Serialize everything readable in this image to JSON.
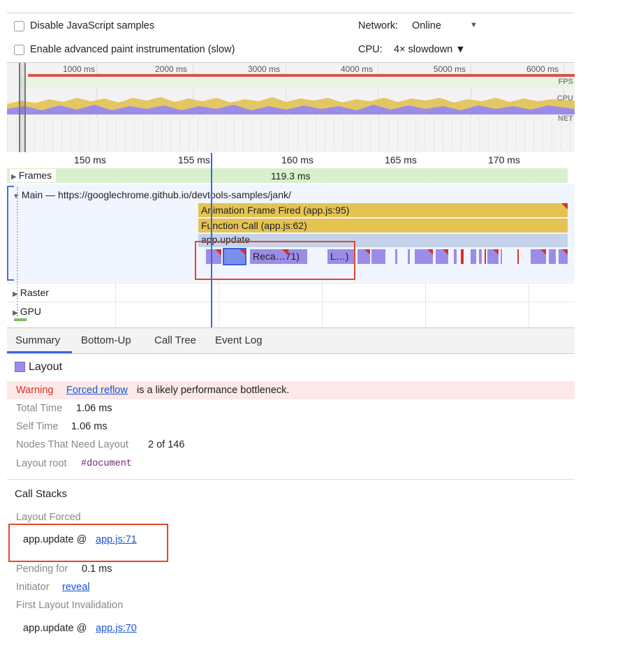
{
  "settings": {
    "disable_js_samples": "Disable JavaScript samples",
    "advanced_paint": "Enable advanced paint instrumentation (slow)",
    "network_label": "Network:",
    "network_value": "Online",
    "network_arrow": "▼",
    "cpu_label": "CPU:",
    "cpu_value": "4× slowdown ▼"
  },
  "overview": {
    "ticks": [
      "1000 ms",
      "2000 ms",
      "3000 ms",
      "4000 ms",
      "5000 ms",
      "6000 ms"
    ],
    "fps": "FPS",
    "cpu": "CPU",
    "net": "NET"
  },
  "ruler": {
    "ticks": [
      "150 ms",
      "155 ms",
      "160 ms",
      "165 ms",
      "170 ms"
    ]
  },
  "tracks": {
    "frames_label": "Frames",
    "frames_duration": "119.3 ms",
    "main_label": "Main — https://googlechrome.github.io/devtools-samples/jank/",
    "animation_frame": "Animation Frame Fired (app.js:95)",
    "function_call": "Function Call (app.js:62)",
    "app_update": "app.update",
    "recalc": "Reca…71)",
    "layout_short": "L…)",
    "raster_label": "Raster",
    "gpu_label": "GPU"
  },
  "tabs": [
    "Summary",
    "Bottom-Up",
    "Call Tree",
    "Event Log"
  ],
  "summary": {
    "title": "Layout",
    "warning_label": "Warning",
    "warning_link": "Forced reflow",
    "warning_text": "is a likely performance bottleneck.",
    "total_time_label": "Total Time",
    "total_time": "1.06 ms",
    "self_time_label": "Self Time",
    "self_time": "1.06 ms",
    "nodes_label": "Nodes That Need Layout",
    "nodes": "2 of 146",
    "layout_root_label": "Layout root",
    "layout_root": "#document"
  },
  "call_stacks": {
    "title": "Call Stacks",
    "layout_forced_label": "Layout Forced",
    "frame1_fn": "app.update @",
    "frame1_link": "app.js:71",
    "pending_label": "Pending for",
    "pending_value": "0.1 ms",
    "initiator_label": "Initiator",
    "initiator_link": "reveal",
    "first_invalidation_label": "First Layout Invalidation",
    "frame2_fn": "app.update @",
    "frame2_link": "app.js:70"
  },
  "colors": {
    "layout_purple": "#9b8ce8",
    "scripting_yellow": "#e5c352",
    "highlight_red": "#e0482c",
    "frames_green": "#d9f0cc",
    "link_blue": "#1a55d8"
  }
}
